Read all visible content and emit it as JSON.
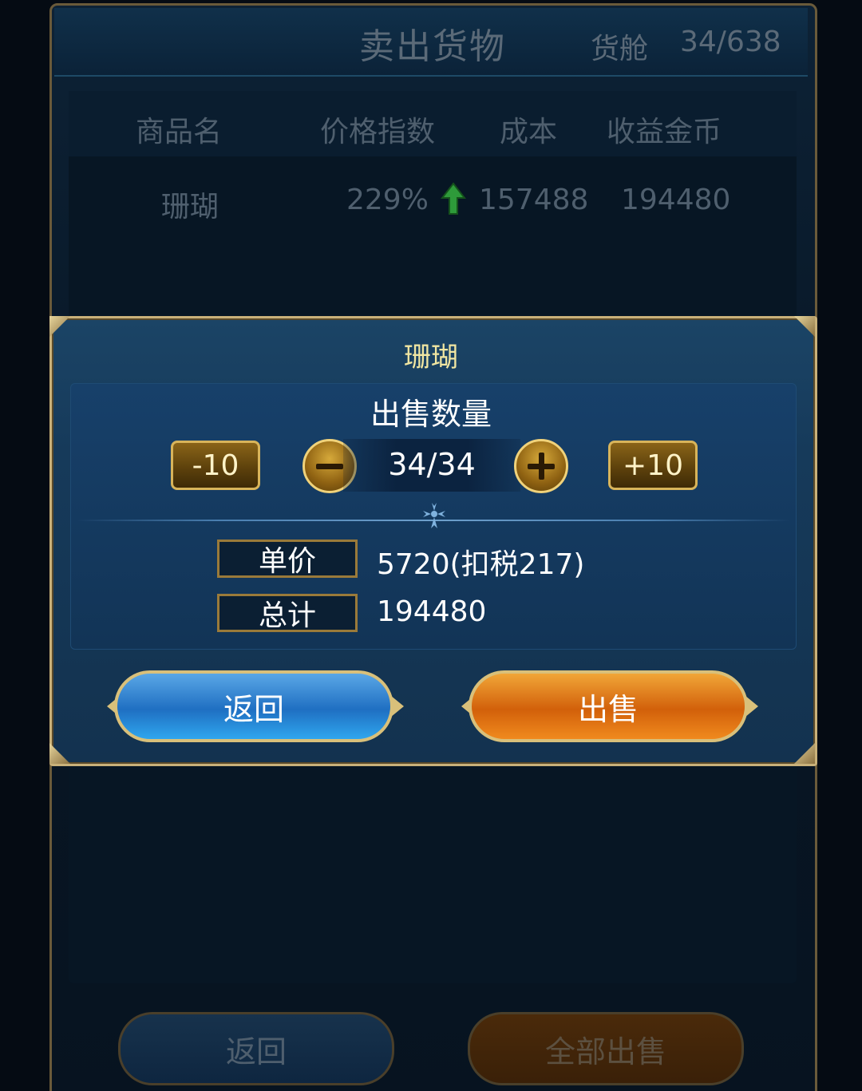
{
  "background": {
    "title": "卖出货物",
    "hold_label": "货舱",
    "hold_value": "34/638",
    "table": {
      "headers": [
        "商品名",
        "价格指数",
        "成本",
        "收益金币"
      ],
      "row": {
        "name": "珊瑚",
        "price_index": "229%",
        "cost": "157488",
        "profit": "194480"
      }
    },
    "buttons": {
      "back": "返回",
      "sell_all": "全部出售"
    }
  },
  "modal": {
    "title": "珊瑚",
    "quantity_label": "出售数量",
    "quantity_value": "34/34",
    "minus_ten": "-10",
    "plus_ten": "+10",
    "unit_price_label": "单价",
    "unit_price_value": "5720(扣税217)",
    "total_label": "总计",
    "total_value": "194480",
    "back_button": "返回",
    "sell_button": "出售"
  },
  "colors": {
    "accent_gold": "#c9b17a",
    "title_yellow": "#f1e6a2",
    "blue_button": "#1f6fc2",
    "orange_button": "#d2600a",
    "trend_up_green": "#2e9a3a"
  }
}
